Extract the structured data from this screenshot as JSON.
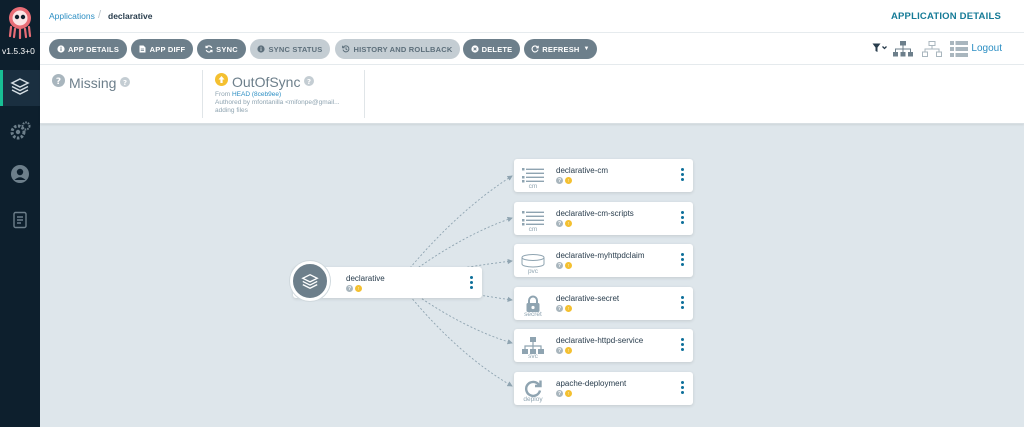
{
  "sidebar": {
    "version": "v1.5.3+0",
    "items": [
      {
        "name": "applications",
        "icon": "layers-icon",
        "active": true
      },
      {
        "name": "settings",
        "icon": "gears-icon",
        "active": false
      },
      {
        "name": "user-info",
        "icon": "user-icon",
        "active": false
      },
      {
        "name": "docs",
        "icon": "docs-icon",
        "active": false
      }
    ]
  },
  "breadcrumb": {
    "parent": "Applications",
    "current": "declarative"
  },
  "page_title": "APPLICATION DETAILS",
  "toolbar": {
    "buttons": [
      {
        "label": "APP DETAILS",
        "icon": "info-icon",
        "disabled": false
      },
      {
        "label": "APP DIFF",
        "icon": "file-icon",
        "disabled": false
      },
      {
        "label": "SYNC",
        "icon": "sync-icon",
        "disabled": false
      },
      {
        "label": "SYNC STATUS",
        "icon": "info-icon",
        "disabled": true
      },
      {
        "label": "HISTORY AND ROLLBACK",
        "icon": "history-icon",
        "disabled": true
      },
      {
        "label": "DELETE",
        "icon": "times-circle-icon",
        "disabled": false
      },
      {
        "label": "REFRESH",
        "icon": "redo-icon",
        "disabled": false
      }
    ],
    "logout": "Logout"
  },
  "status": {
    "health": "Missing",
    "sync": "OutOfSync",
    "from_label": "From",
    "revision": "HEAD (8ceb9ee)",
    "author": "Authored by mfontanilla <mifonpe@gmail...",
    "message": "adding files"
  },
  "graph": {
    "app": {
      "name": "declarative"
    },
    "resources": [
      {
        "name": "declarative-cm",
        "kind": "cm",
        "icon": "list-icon"
      },
      {
        "name": "declarative-cm-scripts",
        "kind": "cm",
        "icon": "list-icon"
      },
      {
        "name": "declarative-myhttpdclaim",
        "kind": "pvc",
        "icon": "database-icon"
      },
      {
        "name": "declarative-secret",
        "kind": "secret",
        "icon": "lock-icon"
      },
      {
        "name": "declarative-httpd-service",
        "kind": "svc",
        "icon": "network-icon"
      },
      {
        "name": "apache-deployment",
        "kind": "deploy",
        "icon": "redo-icon"
      }
    ]
  },
  "colors": {
    "sidebar_bg": "#0d1f2d",
    "button_bg": "#6d7f8b",
    "accent": "#2b8ec3",
    "out_of_sync": "#f4c030",
    "unknown": "#a9b6be"
  }
}
